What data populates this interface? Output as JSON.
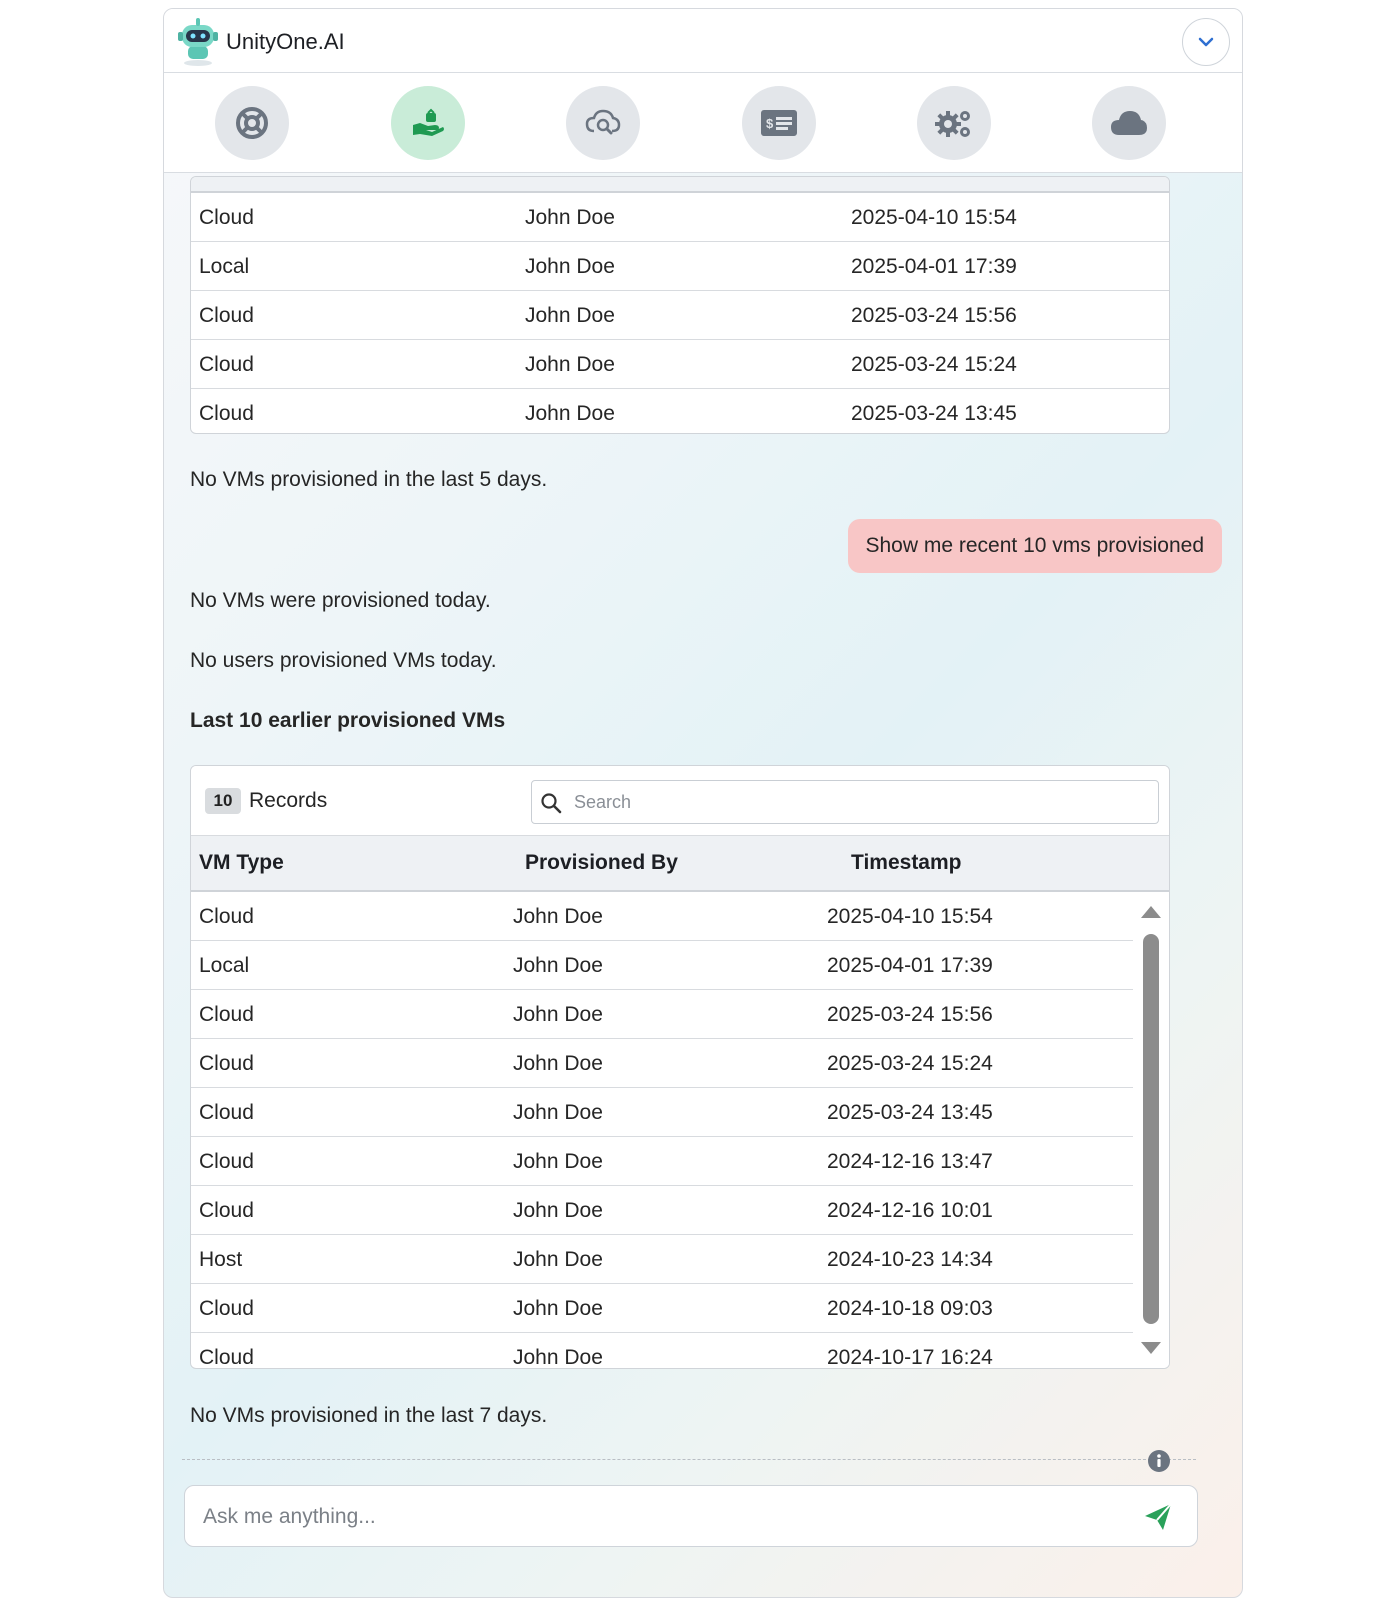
{
  "app": {
    "title": "UnityOne.AI"
  },
  "toolbar": {
    "icons": [
      "lifebuoy-icon",
      "provisioning-hand-icon",
      "cloud-search-icon",
      "billing-card-icon",
      "settings-gears-icon",
      "cloud-icon"
    ],
    "active_index": 1
  },
  "first_table": {
    "rows": [
      [
        "Cloud",
        "John Doe",
        "2025-04-10 15:54"
      ],
      [
        "Local",
        "John Doe",
        "2025-04-01 17:39"
      ],
      [
        "Cloud",
        "John Doe",
        "2025-03-24 15:56"
      ],
      [
        "Cloud",
        "John Doe",
        "2025-03-24 15:24"
      ],
      [
        "Cloud",
        "John Doe",
        "2025-03-24 13:45"
      ]
    ]
  },
  "messages": {
    "no_vms_5_days": "No VMs provisioned in the last 5 days.",
    "user_query": "Show me recent 10 vms provisioned",
    "no_vms_today": "No VMs were provisioned today.",
    "no_users_today": "No users provisioned VMs today.",
    "section_title": "Last 10 earlier provisioned VMs",
    "no_vms_7_days": "No VMs provisioned in the last 7 days."
  },
  "records_table": {
    "count": "10",
    "records_label": "Records",
    "search_placeholder": "Search",
    "columns": [
      "VM Type",
      "Provisioned By",
      "Timestamp"
    ],
    "rows": [
      [
        "Cloud",
        "John Doe",
        "2025-04-10 15:54"
      ],
      [
        "Local",
        "John Doe",
        "2025-04-01 17:39"
      ],
      [
        "Cloud",
        "John Doe",
        "2025-03-24 15:56"
      ],
      [
        "Cloud",
        "John Doe",
        "2025-03-24 15:24"
      ],
      [
        "Cloud",
        "John Doe",
        "2025-03-24 13:45"
      ],
      [
        "Cloud",
        "John Doe",
        "2024-12-16 13:47"
      ],
      [
        "Cloud",
        "John Doe",
        "2024-12-16 10:01"
      ],
      [
        "Host",
        "John Doe",
        "2024-10-23 14:34"
      ],
      [
        "Cloud",
        "John Doe",
        "2024-10-18 09:03"
      ],
      [
        "Cloud",
        "John Doe",
        "2024-10-17 16:24"
      ]
    ]
  },
  "chat_input": {
    "placeholder": "Ask me anything..."
  },
  "colors": {
    "send": "#2aa15a",
    "active_tool": "#c9ecd8",
    "user_bubble": "#f8c6c6",
    "accent_blue": "#2f6fd1"
  }
}
